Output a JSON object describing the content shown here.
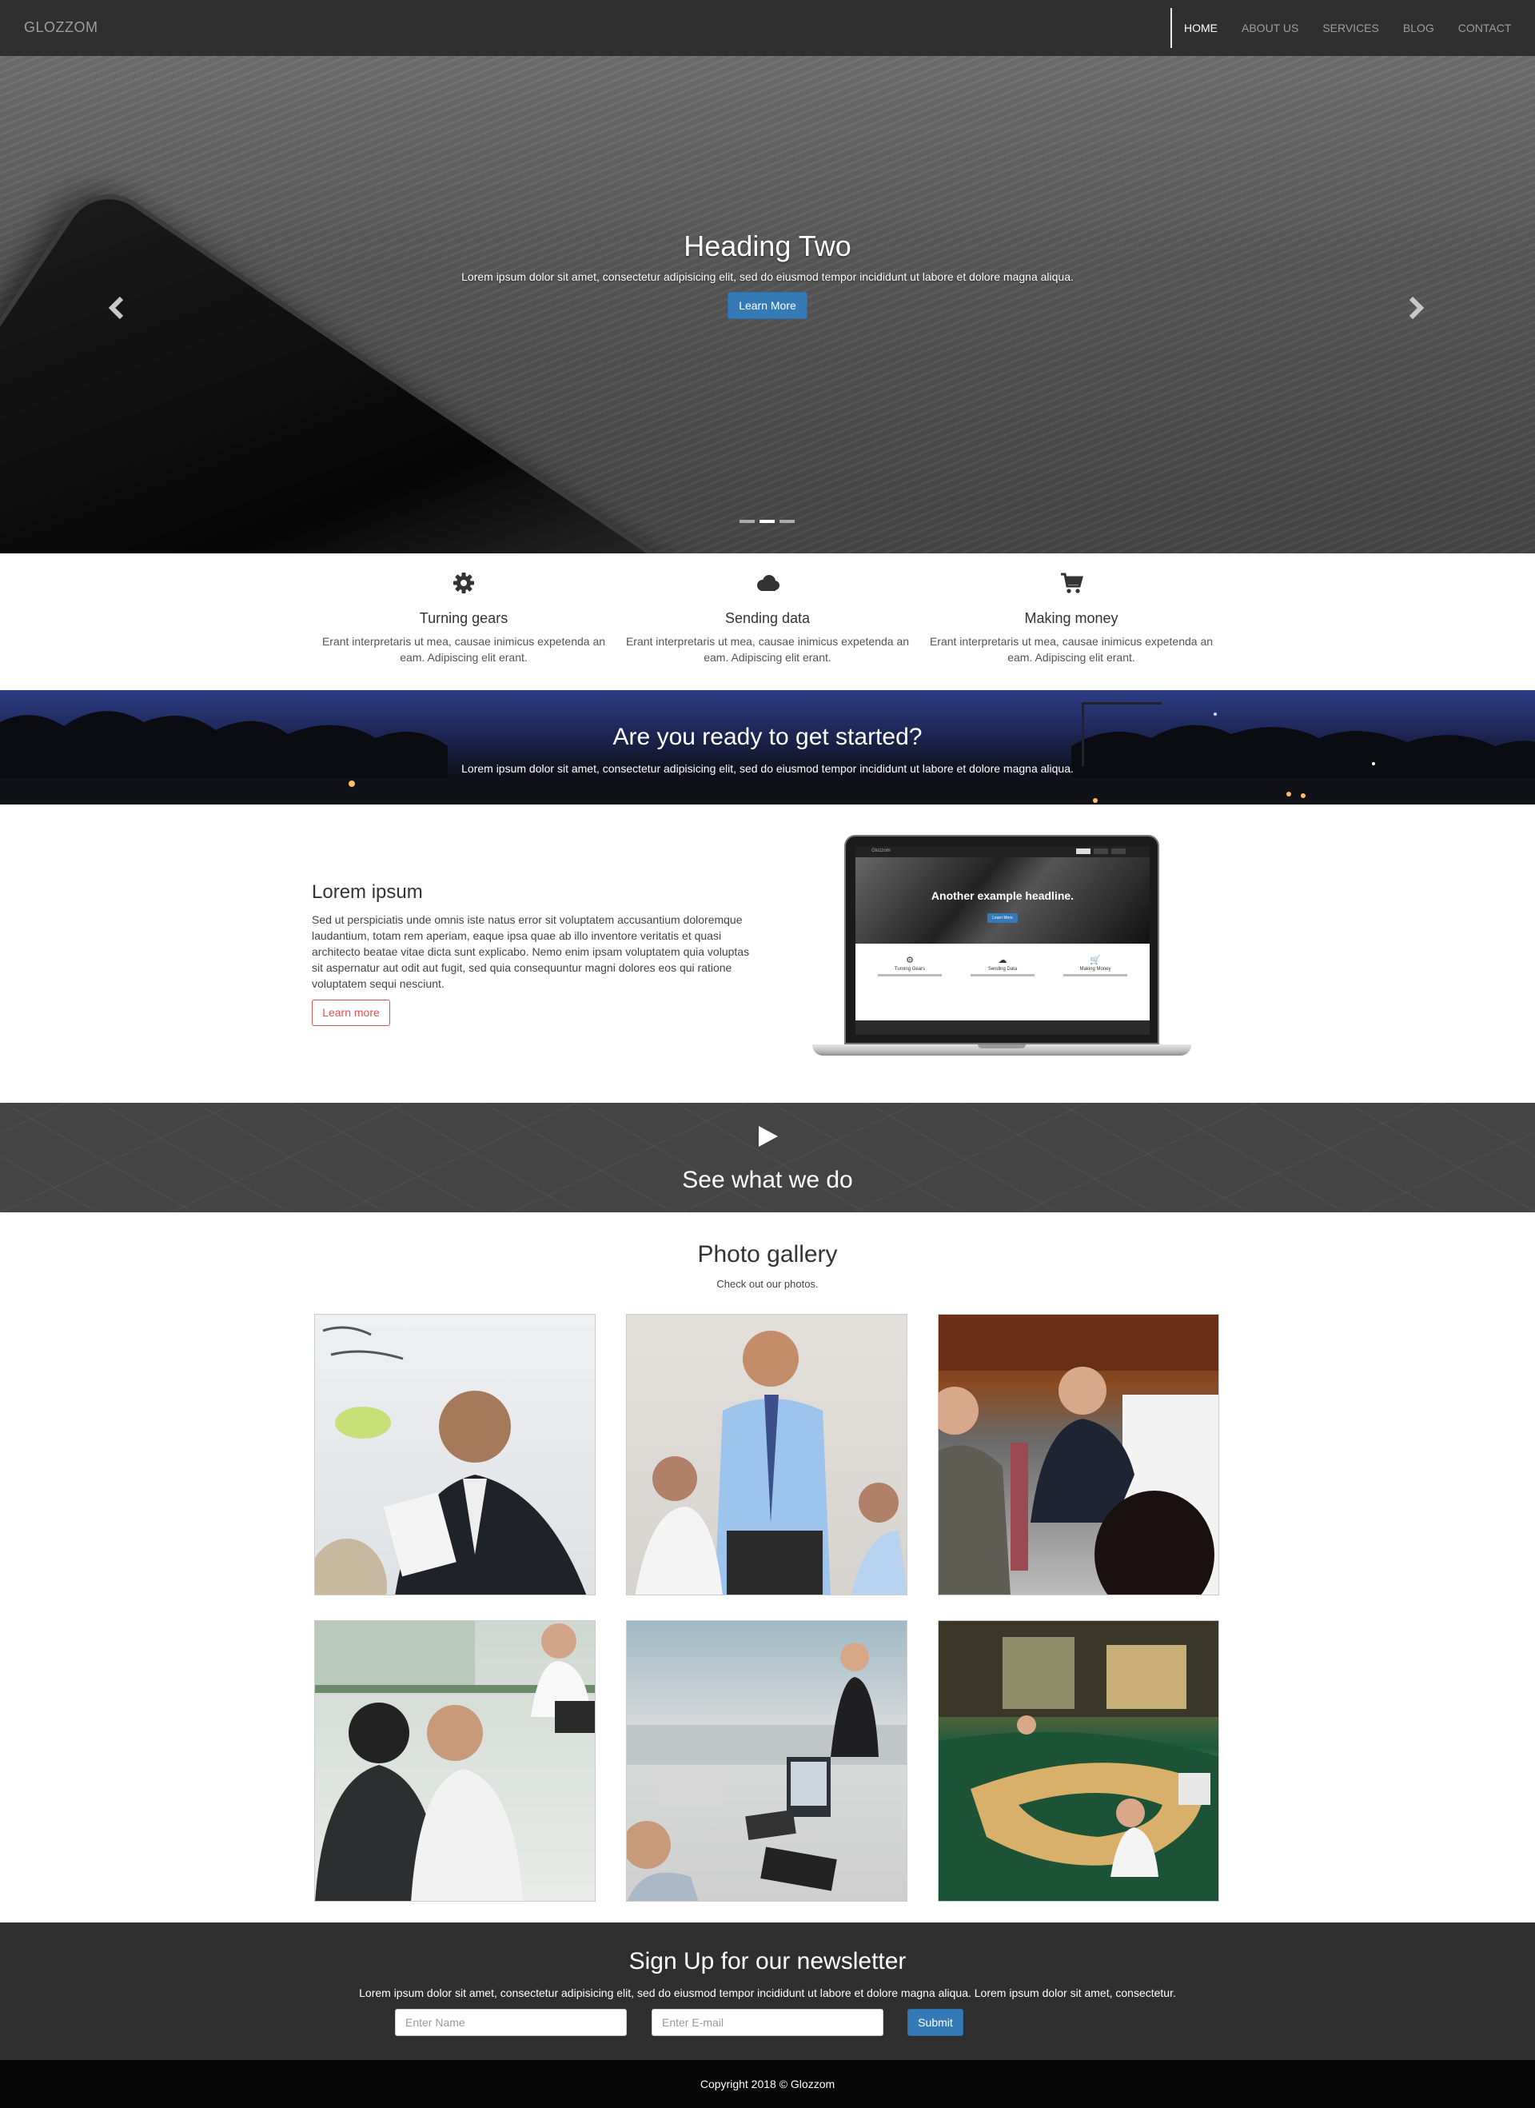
{
  "nav": {
    "brand": "GLOZZOM",
    "links": [
      "HOME",
      "ABOUT US",
      "SERVICES",
      "BLOG",
      "CONTACT"
    ],
    "active": "HOME"
  },
  "hero": {
    "heading": "Heading Two",
    "text": "Lorem ipsum dolor sit amet, consectetur adipisicing elit, sed do eiusmod tempor incididunt ut labore et dolore magna aliqua.",
    "button": "Learn More",
    "prev_icon": "chevron-left-icon",
    "next_icon": "chevron-right-icon",
    "slides": 3,
    "active_slide": 2
  },
  "features": [
    {
      "icon": "gear-icon",
      "title": "Turning gears",
      "text": "Erant interpretaris ut mea, causae inimicus expetenda an eam. Adipiscing elit erant."
    },
    {
      "icon": "cloud-icon",
      "title": "Sending data",
      "text": "Erant interpretaris ut mea, causae inimicus expetenda an eam. Adipiscing elit erant."
    },
    {
      "icon": "cart-icon",
      "title": "Making money",
      "text": "Erant interpretaris ut mea, causae inimicus expetenda an eam. Adipiscing elit erant."
    }
  ],
  "cta": {
    "heading": "Are you ready to get started?",
    "text": "Lorem ipsum dolor sit amet, consectetur adipisicing elit, sed do eiusmod tempor incididunt ut labore et dolore magna aliqua."
  },
  "about": {
    "heading": "Lorem ipsum",
    "text": "Sed ut perspiciatis unde omnis iste natus error sit voluptatem accusantium doloremque laudantium, totam rem aperiam, eaque ipsa quae ab illo inventore veritatis et quasi architecto beatae vitae dicta sunt explicabo. Nemo enim ipsam voluptatem quia voluptas sit aspernatur aut odit aut fugit, sed quia consequuntur magni dolores eos qui ratione voluptatem sequi nesciunt.",
    "button": "Learn more",
    "laptop": {
      "brand": "Glozzom",
      "headline": "Another example headline.",
      "button": "Learn More",
      "features": [
        "Turning Gears",
        "Sending Data",
        "Making Money"
      ]
    }
  },
  "video": {
    "icon": "play-icon",
    "heading": "See what we do"
  },
  "gallery": {
    "heading": "Photo gallery",
    "subtitle": "Check out our photos."
  },
  "newsletter": {
    "heading": "Sign Up for our newsletter",
    "text": "Lorem ipsum dolor sit amet, consectetur adipisicing elit, sed do eiusmod tempor incididunt ut labore et dolore magna aliqua. Lorem ipsum dolor sit amet, consectetur.",
    "name_placeholder": "Enter Name",
    "email_placeholder": "Enter E-mail",
    "submit": "Submit"
  },
  "footer": {
    "copyright": "Copyright 2018 © Glozzom"
  },
  "colors": {
    "nav_bg": "#2f2f2f",
    "primary": "#337ab7",
    "outline_red": "#d9534f",
    "footer_bg": "#070707"
  }
}
